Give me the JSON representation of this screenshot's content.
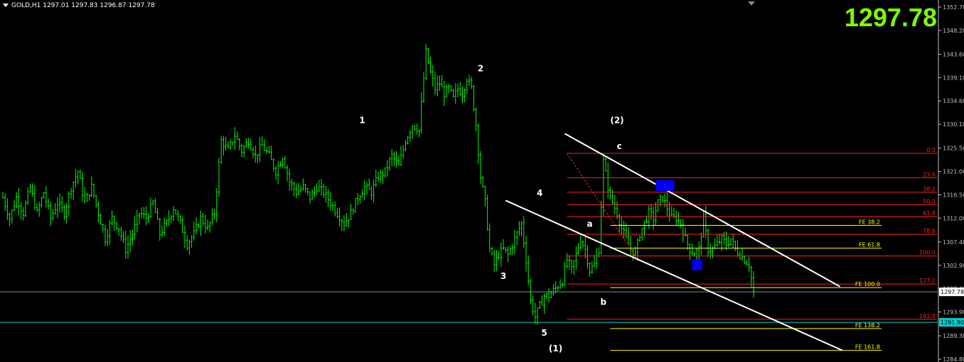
{
  "window": {
    "symbol_line": "GOLD,H1  1297.01 1297.83 1296.87 1297.78",
    "big_price": "1297.78"
  },
  "colors": {
    "background": "#000000",
    "candle": "#00ff00",
    "axis_text": "#c0c0c0",
    "fib_retracement": "#ff2020",
    "fib_extension": "#ffff00",
    "channel": "#ffffff",
    "price_line": "#87ceeb",
    "cyan_line": "#00ced1",
    "blue_box": "#0000ff",
    "big_price": "#7cfc00"
  },
  "chart_data": {
    "type": "candlestick",
    "symbol": "GOLD",
    "timeframe": "H1",
    "ohlc": {
      "open": 1297.01,
      "high": 1297.83,
      "low": 1296.87,
      "close": 1297.78
    },
    "ylim": [
      1284.8,
      1352.7
    ],
    "y_ticks": [
      "1352.70",
      "1348.20",
      "1343.60",
      "1339.10",
      "1334.60",
      "1330.10",
      "1325.50",
      "1321.00",
      "1316.50",
      "1312.00",
      "1307.40",
      "1302.90",
      "1298.40",
      "1293.90",
      "1289.30",
      "1284.80"
    ],
    "price_labels": [
      {
        "text": "1297.78",
        "value": 1297.78,
        "style": "current"
      },
      {
        "text": "1291.90",
        "value": 1291.9,
        "style": "cyan"
      }
    ],
    "horizontal_lines": [
      {
        "value": 1297.78,
        "color": "#6a9aa8"
      },
      {
        "value": 1291.9,
        "color": "#00ced1"
      }
    ],
    "close_path": [
      [
        0,
        1316
      ],
      [
        3,
        1312
      ],
      [
        6,
        1316
      ],
      [
        9,
        1313
      ],
      [
        12,
        1318
      ],
      [
        15,
        1313
      ],
      [
        18,
        1317
      ],
      [
        21,
        1312
      ],
      [
        24,
        1315
      ],
      [
        27,
        1313
      ],
      [
        30,
        1318
      ],
      [
        33,
        1321
      ],
      [
        36,
        1315
      ],
      [
        39,
        1318
      ],
      [
        42,
        1313
      ],
      [
        45,
        1308
      ],
      [
        48,
        1312
      ],
      [
        51,
        1310
      ],
      [
        54,
        1306
      ],
      [
        57,
        1309
      ],
      [
        60,
        1313
      ],
      [
        63,
        1312
      ],
      [
        66,
        1315
      ],
      [
        69,
        1309
      ],
      [
        72,
        1311
      ],
      [
        75,
        1314
      ],
      [
        78,
        1311
      ],
      [
        81,
        1307
      ],
      [
        84,
        1309
      ],
      [
        87,
        1312
      ],
      [
        90,
        1310
      ],
      [
        93,
        1313
      ],
      [
        96,
        1327
      ],
      [
        99,
        1325
      ],
      [
        102,
        1328
      ],
      [
        105,
        1325
      ],
      [
        108,
        1327
      ],
      [
        111,
        1324
      ],
      [
        114,
        1326
      ],
      [
        117,
        1324
      ],
      [
        120,
        1321
      ],
      [
        123,
        1324
      ],
      [
        126,
        1319
      ],
      [
        129,
        1317
      ],
      [
        132,
        1318
      ],
      [
        135,
        1316
      ],
      [
        138,
        1318
      ],
      [
        141,
        1317
      ],
      [
        144,
        1315
      ],
      [
        147,
        1313
      ],
      [
        150,
        1311
      ],
      [
        153,
        1313
      ],
      [
        156,
        1316
      ],
      [
        159,
        1318
      ],
      [
        162,
        1317
      ],
      [
        165,
        1320
      ],
      [
        168,
        1321
      ],
      [
        171,
        1324
      ],
      [
        174,
        1322
      ],
      [
        177,
        1327
      ],
      [
        180,
        1330
      ],
      [
        183,
        1329
      ],
      [
        186,
        1344
      ],
      [
        188,
        1340
      ],
      [
        190,
        1337
      ],
      [
        192,
        1338
      ],
      [
        194,
        1336
      ],
      [
        196,
        1337
      ],
      [
        198,
        1335
      ],
      [
        200,
        1337
      ],
      [
        202,
        1336
      ],
      [
        204,
        1339
      ],
      [
        206,
        1337
      ],
      [
        208,
        1330
      ],
      [
        210,
        1320
      ],
      [
        212,
        1315
      ],
      [
        214,
        1306
      ],
      [
        216,
        1303
      ],
      [
        218,
        1305
      ],
      [
        220,
        1306
      ],
      [
        222,
        1305
      ],
      [
        224,
        1307
      ],
      [
        226,
        1309
      ],
      [
        228,
        1311
      ],
      [
        230,
        1304
      ],
      [
        232,
        1296
      ],
      [
        234,
        1293
      ],
      [
        236,
        1295
      ],
      [
        238,
        1297
      ],
      [
        240,
        1297
      ],
      [
        242,
        1298
      ],
      [
        244,
        1299
      ],
      [
        246,
        1300
      ],
      [
        248,
        1304
      ],
      [
        250,
        1302
      ],
      [
        252,
        1305
      ],
      [
        254,
        1308
      ],
      [
        256,
        1306
      ],
      [
        258,
        1302
      ],
      [
        260,
        1303
      ],
      [
        262,
        1306
      ],
      [
        264,
        1323
      ],
      [
        266,
        1318
      ],
      [
        268,
        1315
      ],
      [
        270,
        1313
      ],
      [
        272,
        1310
      ],
      [
        274,
        1308
      ],
      [
        276,
        1306
      ],
      [
        278,
        1305
      ],
      [
        280,
        1309
      ],
      [
        282,
        1311
      ],
      [
        284,
        1313
      ],
      [
        286,
        1312
      ],
      [
        288,
        1315
      ],
      [
        290,
        1316
      ],
      [
        292,
        1314
      ],
      [
        294,
        1312
      ],
      [
        296,
        1312
      ],
      [
        298,
        1311
      ],
      [
        300,
        1308
      ],
      [
        302,
        1306
      ],
      [
        304,
        1305
      ],
      [
        306,
        1306
      ],
      [
        308,
        1312
      ],
      [
        310,
        1306
      ],
      [
        312,
        1306
      ],
      [
        314,
        1307
      ],
      [
        316,
        1308
      ],
      [
        318,
        1307
      ],
      [
        320,
        1308
      ],
      [
        322,
        1306
      ],
      [
        324,
        1305
      ],
      [
        326,
        1304
      ],
      [
        328,
        1303
      ],
      [
        330,
        1297.78
      ]
    ],
    "fib_levels": [
      {
        "label": "0.0",
        "value": 1324.5
      },
      {
        "label": "23.6",
        "value": 1319.8
      },
      {
        "label": "38.2",
        "value": 1317.0
      },
      {
        "label": "50.0",
        "value": 1314.6
      },
      {
        "label": "61.8",
        "value": 1312.3
      },
      {
        "label": "78.6",
        "value": 1308.9
      },
      {
        "label": "100.0",
        "value": 1304.7
      },
      {
        "label": "127.2",
        "value": 1299.3
      },
      {
        "label": "161.8",
        "value": 1292.5
      }
    ],
    "fe_levels": [
      {
        "label": "FE 38.2",
        "value": 1310.6
      },
      {
        "label": "FE 61.8",
        "value": 1306.2
      },
      {
        "label": "FE 100.0",
        "value": 1298.6
      },
      {
        "label": "FE 138.2",
        "value": 1290.7
      },
      {
        "label": "FE 161.8",
        "value": 1286.5
      }
    ],
    "wave_labels": [
      {
        "text": "1",
        "x": 158,
        "y": 1330.3
      },
      {
        "text": "2",
        "x": 210,
        "y": 1340.3
      },
      {
        "text": "3",
        "x": 220,
        "y": 1300.3
      },
      {
        "text": "4",
        "x": 236,
        "y": 1316.3
      },
      {
        "text": "5",
        "x": 238,
        "y": 1289.3
      },
      {
        "text": "(1)",
        "x": 243,
        "y": 1286.3
      },
      {
        "text": "a",
        "x": 258,
        "y": 1310.3
      },
      {
        "text": "b",
        "x": 264,
        "y": 1295.3
      },
      {
        "text": "(2)",
        "x": 270,
        "y": 1330.3
      },
      {
        "text": "c",
        "x": 271,
        "y": 1325.3
      }
    ]
  }
}
